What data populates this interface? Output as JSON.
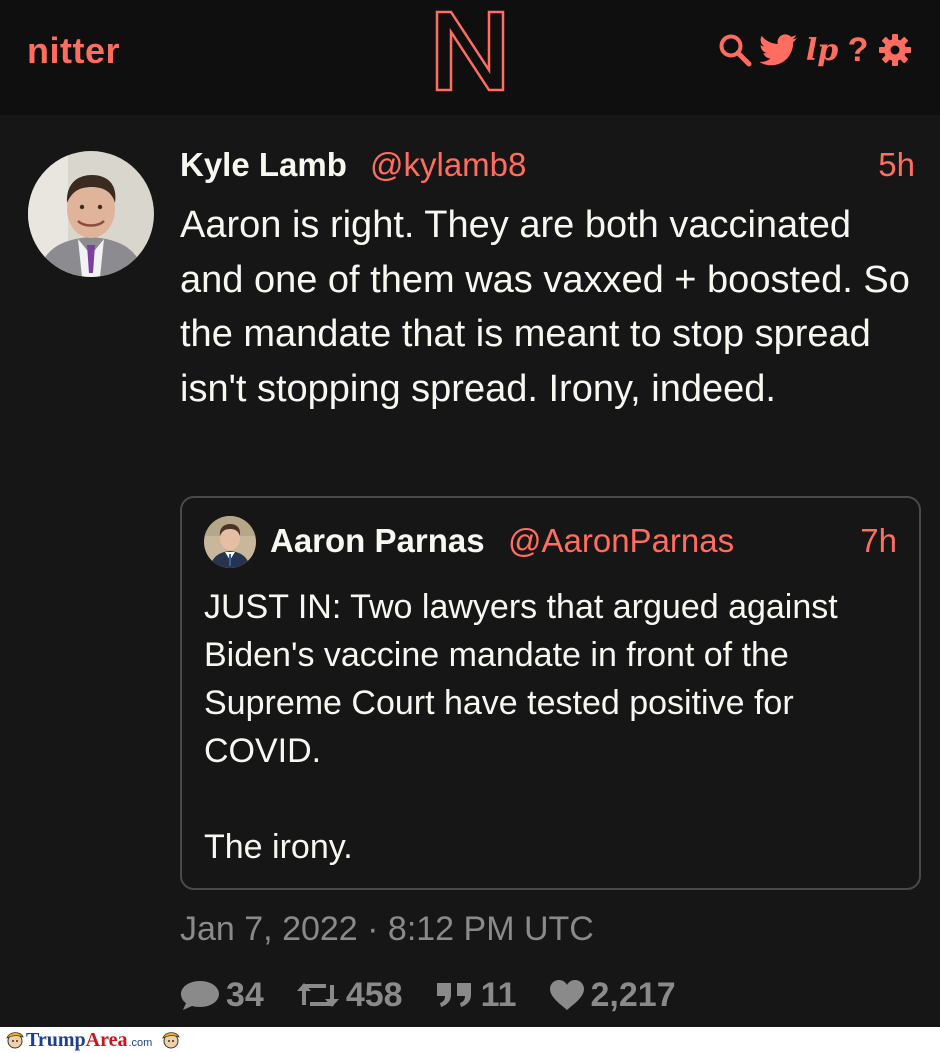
{
  "navbar": {
    "brand": "nitter",
    "logo_letter": "N",
    "icons": [
      "search-icon",
      "twitter-bird-icon",
      "lp-icon",
      "help-icon",
      "gear-icon"
    ],
    "lp_label": "lp",
    "help_label": "?",
    "accent": "#ff6c60"
  },
  "tweet": {
    "fullname": "Kyle Lamb",
    "username": "@kylamb8",
    "date": "5h",
    "text": "Aaron is right. They are both vaccinated and one of them was vaxxed + boosted. So the mandate that is meant to stop spread isn't stopping spread. Irony, indeed.",
    "published": "Jan 7, 2022 · 8:12 PM UTC",
    "stats": {
      "replies": "34",
      "retweets": "458",
      "quotes": "11",
      "likes": "2,217"
    }
  },
  "quote": {
    "fullname": "Aaron Parnas",
    "username": "@AaronParnas",
    "date": "7h",
    "text": "JUST IN: Two lawyers that argued against Biden's vaccine mandate in front of the Supreme Court have tested positive for COVID.\n\nThe irony."
  },
  "watermark": {
    "part1": "Trump",
    "part2": "Area",
    "suffix": ".com"
  }
}
